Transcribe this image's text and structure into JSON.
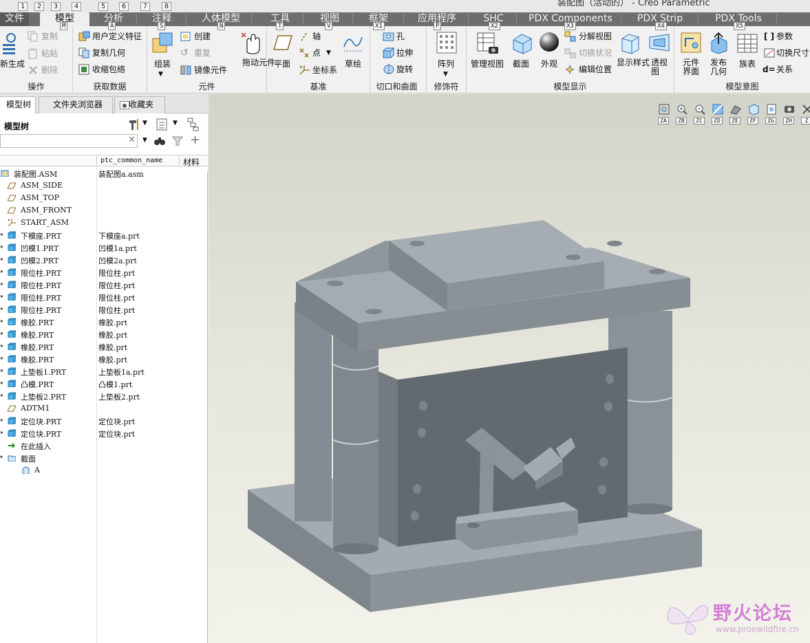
{
  "quick_access": {
    "keys": [
      "1",
      "2",
      "3",
      "4",
      "5",
      "6",
      "7",
      "8"
    ]
  },
  "window_title": "装配图（活动的） - Creo Parametric",
  "tabs": [
    {
      "label": "文件",
      "key": ""
    },
    {
      "label": "模型",
      "key": "M"
    },
    {
      "label": "分析",
      "key": "A"
    },
    {
      "label": "注释",
      "key": "S"
    },
    {
      "label": "人体模型",
      "key": "N"
    },
    {
      "label": "工具",
      "key": "T"
    },
    {
      "label": "视图",
      "key": "V"
    },
    {
      "label": "框架",
      "key": "X1"
    },
    {
      "label": "应用程序",
      "key": "P"
    },
    {
      "label": "SHC",
      "key": "X2"
    },
    {
      "label": "PDX Components",
      "key": "X3"
    },
    {
      "label": "PDX Strip",
      "key": "X4"
    },
    {
      "label": "PDX Tools",
      "key": "X5"
    }
  ],
  "ribbon": {
    "operations": {
      "label": "操作",
      "regen": "新生成",
      "copy": "复制",
      "paste": "粘贴",
      "delete": "删除"
    },
    "get_data": {
      "label": "获取数据",
      "udf": "用户定义特征",
      "copy_geom": "复制几何",
      "shrinkwrap": "收缩包络"
    },
    "component": {
      "label": "元件",
      "assemble": "组装",
      "create": "创建",
      "repeat": "重复",
      "mirror": "镜像元件",
      "drag": "拖动元件"
    },
    "datum": {
      "label": "基准",
      "plane": "平面",
      "axis": "轴",
      "point": "点",
      "csys": "坐标系",
      "sketch": "草绘"
    },
    "cut_surface": {
      "label": "切口和曲面",
      "hole": "孔",
      "extrude": "拉伸",
      "revolve": "旋转"
    },
    "modifiers": {
      "label": "修饰符",
      "pattern": "阵列"
    },
    "model_display": {
      "label": "模型显示",
      "manage_views": "管理视图",
      "section": "截面",
      "appearance": "外观",
      "explode": "分解视图",
      "toggle_status": "切换状况",
      "edit_position": "编辑位置",
      "display_style": "显示样式",
      "perspective": "透视图"
    },
    "model_intent": {
      "label": "模型意图",
      "component_interface": "元件界面",
      "publish_geom": "发布几何",
      "family_table": "族表",
      "parameters": "参数",
      "switch_dims": "切换尺寸",
      "relations": "关系"
    }
  },
  "left_panel": {
    "tabs": [
      "模型树",
      "文件夹浏览器",
      "收藏夹"
    ],
    "tree_title": "模型树",
    "columns": [
      "ptc_common_name",
      "材料"
    ],
    "rows": [
      {
        "name": "装配图.ASM",
        "common": "装配图a.asm",
        "icon": "assembly-icon",
        "indent": 0
      },
      {
        "name": "ASM_SIDE",
        "common": "",
        "icon": "datum-plane-icon",
        "indent": 1
      },
      {
        "name": "ASM_TOP",
        "common": "",
        "icon": "datum-plane-icon",
        "indent": 1
      },
      {
        "name": "ASM_FRONT",
        "common": "",
        "icon": "datum-plane-icon",
        "indent": 1
      },
      {
        "name": "START_ASM",
        "common": "",
        "icon": "csys-icon",
        "indent": 1
      },
      {
        "name": "下模座.PRT",
        "common": "下模座a.prt",
        "icon": "part-icon",
        "indent": 1
      },
      {
        "name": "凹模1.PRT",
        "common": "凹模1a.prt",
        "icon": "part-icon",
        "indent": 1
      },
      {
        "name": "凹模2.PRT",
        "common": "凹模2a.prt",
        "icon": "part-icon",
        "indent": 1
      },
      {
        "name": "限位柱.PRT",
        "common": "限位柱.prt",
        "icon": "part-icon",
        "indent": 1
      },
      {
        "name": "限位柱.PRT",
        "common": "限位柱.prt",
        "icon": "part-icon",
        "indent": 1
      },
      {
        "name": "限位柱.PRT",
        "common": "限位柱.prt",
        "icon": "part-icon",
        "indent": 1
      },
      {
        "name": "限位柱.PRT",
        "common": "限位柱.prt",
        "icon": "part-icon",
        "indent": 1
      },
      {
        "name": "橡胶.PRT",
        "common": "橡胶.prt",
        "icon": "part-icon",
        "indent": 1
      },
      {
        "name": "橡胶.PRT",
        "common": "橡胶.prt",
        "icon": "part-icon",
        "indent": 1
      },
      {
        "name": "橡胶.PRT",
        "common": "橡胶.prt",
        "icon": "part-icon",
        "indent": 1
      },
      {
        "name": "橡胶.PRT",
        "common": "橡胶.prt",
        "icon": "part-icon",
        "indent": 1
      },
      {
        "name": "上垫板1.PRT",
        "common": "上垫板1a.prt",
        "icon": "part-icon",
        "indent": 1
      },
      {
        "name": "凸模.PRT",
        "common": "凸模1.prt",
        "icon": "part-icon",
        "indent": 1
      },
      {
        "name": "上垫板2.PRT",
        "common": "上垫板2.prt",
        "icon": "part-icon",
        "indent": 1
      },
      {
        "name": "ADTM1",
        "common": "",
        "icon": "datum-plane-icon",
        "indent": 1
      },
      {
        "name": "定位块.PRT",
        "common": "定位块.prt",
        "icon": "part-icon",
        "indent": 1
      },
      {
        "name": "定位块.PRT",
        "common": "定位块.prt",
        "icon": "part-icon",
        "indent": 1
      },
      {
        "name": "在此插入",
        "common": "",
        "icon": "insert-here-icon",
        "indent": 1
      },
      {
        "name": "截面",
        "common": "",
        "icon": "section-folder-icon",
        "indent": 1
      },
      {
        "name": "A",
        "common": "",
        "icon": "section-icon",
        "indent": 2
      }
    ]
  },
  "view_toolbar": {
    "keys": [
      "ZA",
      "ZB",
      "ZC",
      "ZD",
      "ZE",
      "ZF",
      "ZG",
      "ZH",
      "Z"
    ],
    "icons": [
      "refit-icon",
      "zoom-in-icon",
      "zoom-out-icon",
      "repaint-icon",
      "display-style-icon",
      "saved-orientations-icon",
      "view-manager-icon",
      "named-views-icon",
      "more-icon"
    ]
  },
  "watermark": {
    "title": "野火论坛",
    "url": "www.proewildfire.cn"
  },
  "colors": {
    "tabbar": "#6e6e6e",
    "ribbon": "#f1f1f1",
    "model": "#8e959b",
    "viewport_top": "#d2d3c9"
  }
}
